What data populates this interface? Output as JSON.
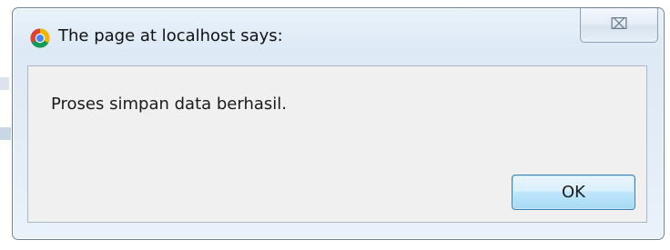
{
  "dialog": {
    "title": "The page at localhost says:",
    "title_icon": "chrome-icon",
    "close_glyph": "⌧",
    "message": "Proses simpan data berhasil.",
    "ok_label": "OK"
  },
  "colors": {
    "frame_border": "#6e8296",
    "frame_background": "#dde9f5",
    "content_background": "#f0f0f0",
    "ok_button_border": "#3c7fb1",
    "ok_button_fill": "#bee6fd"
  }
}
